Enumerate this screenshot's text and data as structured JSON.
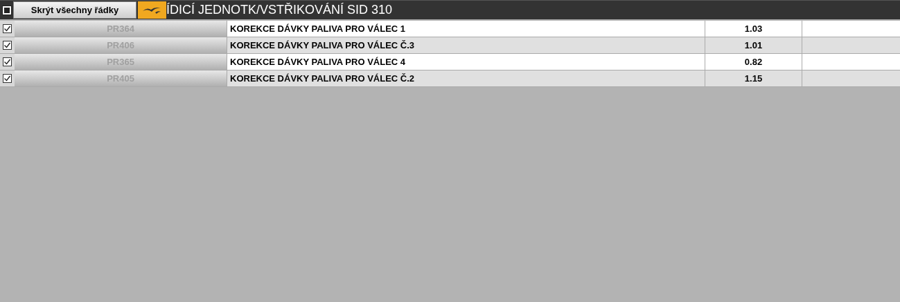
{
  "toolbar": {
    "select_all": {
      "indeterminate": true
    },
    "hide_button": "Skrýt všechny řádky",
    "title": "ÍDICÍ JEDNOTK/VSTŘIKOVÁNÍ SID 310"
  },
  "rows": [
    {
      "checked": true,
      "code": "PR364",
      "description": "KOREKCE DÁVKY PALIVA PRO VÁLEC 1",
      "value": "1.03"
    },
    {
      "checked": true,
      "code": "PR406",
      "description": "KOREKCE DÁVKY PALIVA PRO VÁLEC Č.3",
      "value": "1.01"
    },
    {
      "checked": true,
      "code": "PR365",
      "description": "KOREKCE DÁVKY PALIVA PRO VÁLEC 4",
      "value": "0.82"
    },
    {
      "checked": true,
      "code": "PR405",
      "description": "KOREKCE DÁVKY PALIVA PRO VÁLEC Č.2",
      "value": "1.15"
    }
  ]
}
